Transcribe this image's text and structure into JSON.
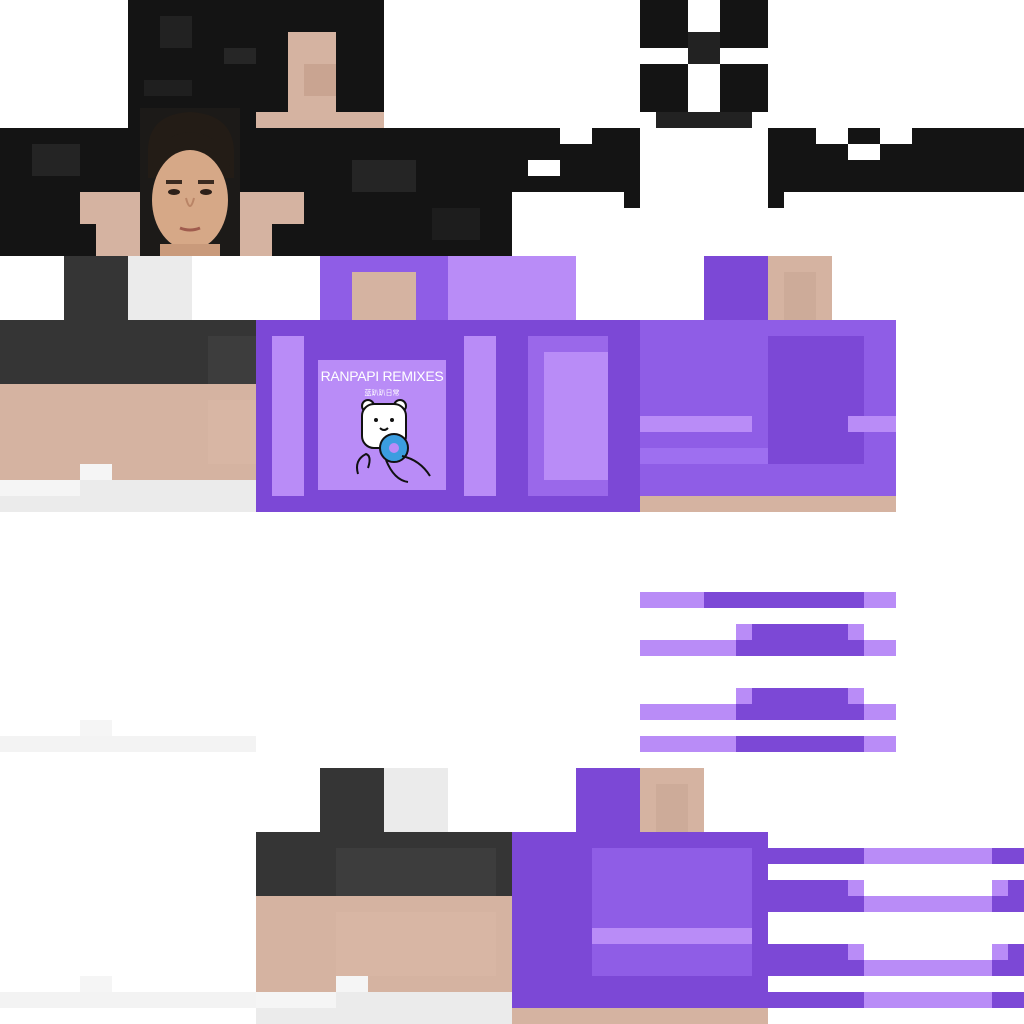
{
  "texture": {
    "kind": "minecraft-skin-texture",
    "colors": {
      "hair_dark": "#141414",
      "hair_mid": "#2a2a2a",
      "skin": "#d5b3a1",
      "skin_shadow": "#c8a28f",
      "shirt_dark": "#353535",
      "shirt_white": "#ebebeb",
      "purple": "#7c48d6",
      "purple_mid": "#8f5de6",
      "purple_light": "#b98cf7",
      "background": "#ffffff"
    }
  },
  "album": {
    "title": "RANPAPI REMIXES",
    "subtitle": "蓝趴趴日常",
    "icon": "polar-bear-with-donut-icon"
  },
  "face_photo": {
    "icon": "human-face-photo-icon"
  }
}
